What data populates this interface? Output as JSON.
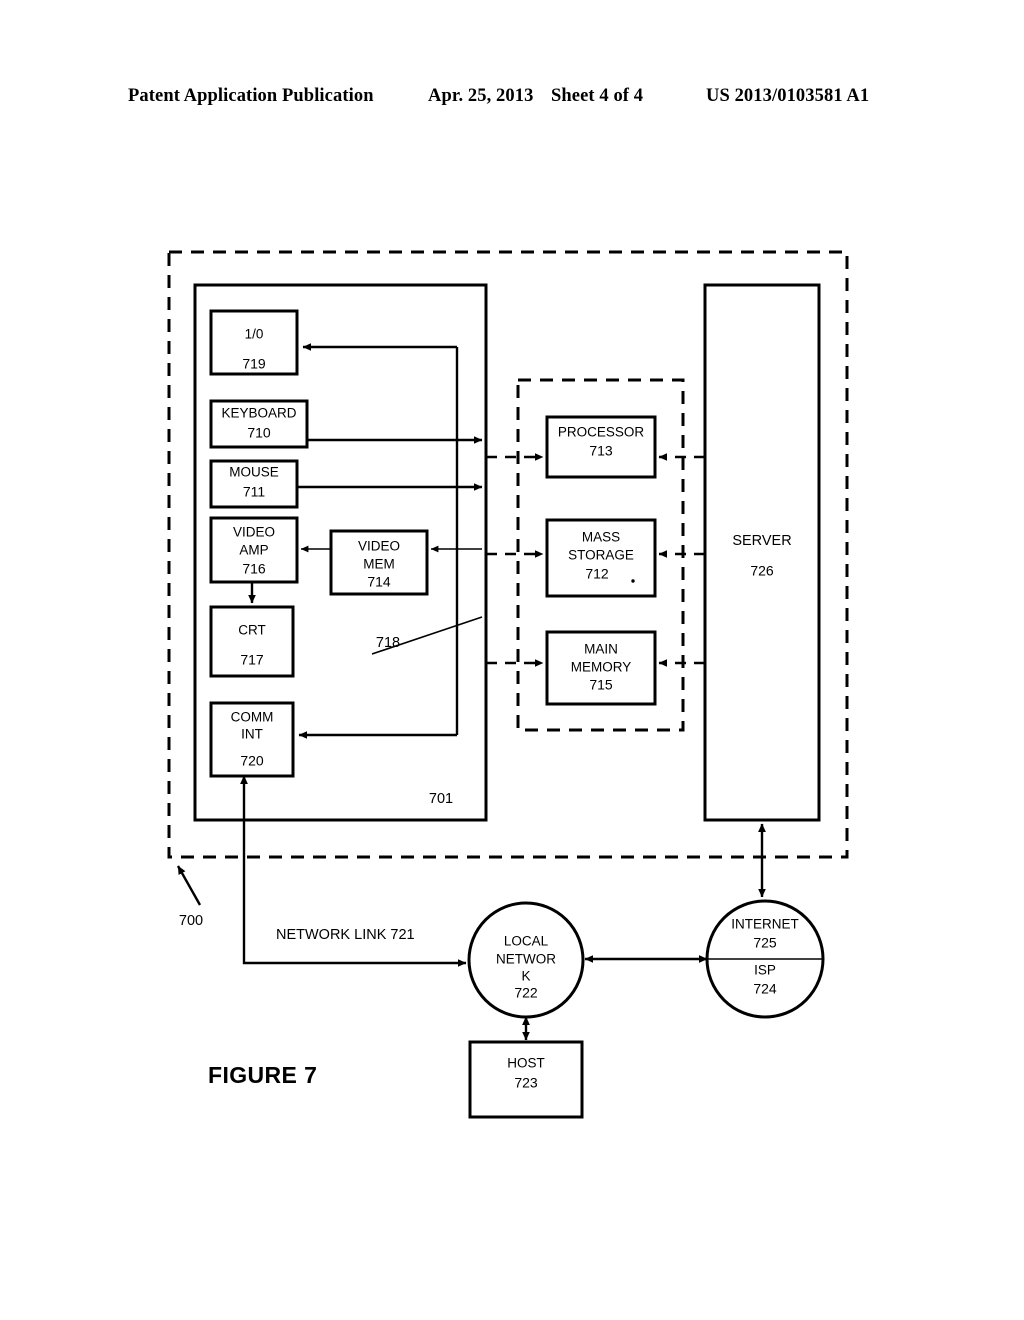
{
  "header": {
    "publication": "Patent Application Publication",
    "date": "Apr. 25, 2013",
    "sheet": "Sheet 4 of 4",
    "number": "US 2013/0103581 A1"
  },
  "figure": {
    "caption": "FIGURE 7",
    "system_ref": "700",
    "computer_ref": "701",
    "bus_ref": "718",
    "network_link_label": "NETWORK LINK 721"
  },
  "blocks": {
    "io": {
      "label": "1/0",
      "ref": "719"
    },
    "keyboard": {
      "label": "KEYBOARD",
      "ref": "710"
    },
    "mouse": {
      "label": "MOUSE",
      "ref": "711"
    },
    "video_amp": {
      "line1": "VIDEO",
      "line2": "AMP",
      "ref": "716"
    },
    "video_mem": {
      "line1": "VIDEO",
      "line2": "MEM",
      "ref": "714"
    },
    "crt": {
      "label": "CRT",
      "ref": "717"
    },
    "comm_int": {
      "line1": "COMM",
      "line2": "INT",
      "ref": "720"
    },
    "processor": {
      "label": "PROCESSOR",
      "ref": "713"
    },
    "mass_storage": {
      "line1": "MASS",
      "line2": "STORAGE",
      "ref": "712"
    },
    "main_memory": {
      "line1": "MAIN",
      "line2": "MEMORY",
      "ref": "715"
    },
    "server": {
      "label": "SERVER",
      "ref": "726"
    },
    "local_network": {
      "line1": "LOCAL",
      "line2": "NETWOR",
      "line3": "K",
      "ref": "722"
    },
    "host": {
      "label": "HOST",
      "ref": "723"
    },
    "internet": {
      "label": "INTERNET",
      "ref": "725"
    },
    "isp": {
      "label": "ISP",
      "ref": "724"
    }
  },
  "colors": {
    "ink": "#000000",
    "paper": "#ffffff"
  }
}
